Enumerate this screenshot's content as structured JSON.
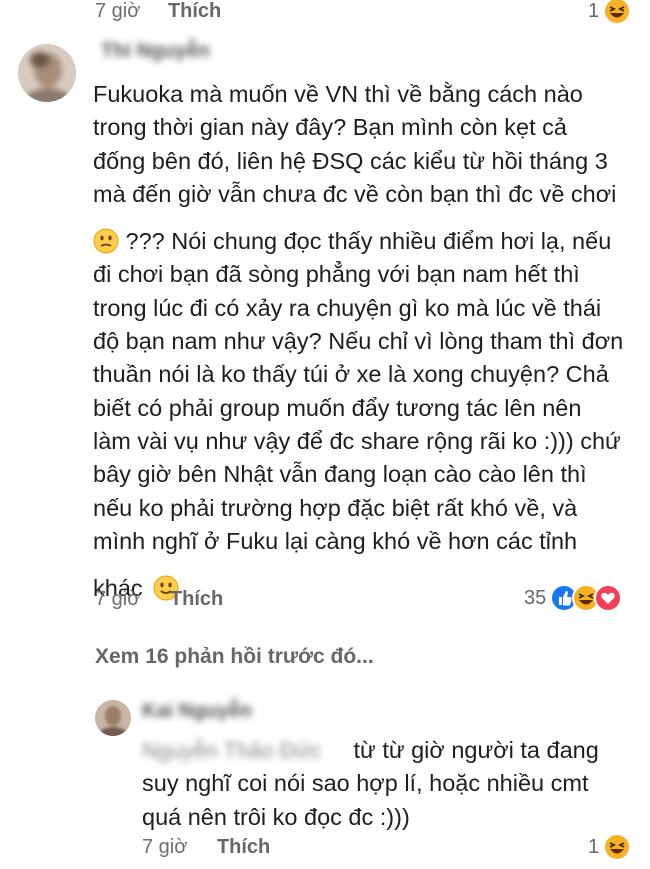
{
  "top_meta": {
    "time": "7 giờ",
    "like_action": "Thích",
    "reaction_count": "1"
  },
  "comment": {
    "author_blurred": "Thi Nguyễn",
    "paragraph1": [
      "Fukuoka mà muốn về VN thì về bằng cách nào",
      "trong thời gian này đây? Bạn mình còn kẹt cả",
      "đống bên đó, liên hệ ĐSQ các kiểu từ hồi tháng 3",
      "mà đến giờ vẫn chưa đc về còn bạn thì đc về chơi"
    ],
    "paragraph2_first_tail": "??? Nói chung đọc thấy nhiều điểm hơi lạ, nếu",
    "paragraph2": [
      "đi chơi bạn đã sòng phẳng với bạn nam hết thì",
      "trong lúc đi có xảy ra chuyện gì ko mà lúc về thái",
      "độ bạn nam như vậy? Nếu chỉ vì lòng tham thì đơn",
      "thuần nói là ko thấy túi ở xe là xong chuyện? Chả",
      "biết có phải group muốn đẩy tương tác lên nên",
      "làm vài vụ như vậy để đc share rộng rãi ko :))) chứ",
      "bây giờ bên Nhật vẫn đang loạn cào cào lên thì",
      "nếu ko phải trường hợp đặc biệt rất khó về, và",
      "mình nghĩ ở Fuku lại càng khó về hơn các tỉnh"
    ],
    "paragraph3_head": "khác",
    "time": "7 giờ",
    "like_action": "Thích",
    "reaction_count": "35"
  },
  "view_more": "Xem 16 phản hồi trước đó...",
  "reply": {
    "author_blurred": "Kai Nguyễn",
    "mention_blurred": "Nguyễn Thảo Đức",
    "first_line_tail": "từ từ giờ người ta đang",
    "lines": [
      "suy nghĩ coi nói sao hợp lí, hoặc nhiều cmt",
      "quá nên trôi ko đọc đc :)))"
    ],
    "time": "7 giờ",
    "like_action": "Thích",
    "reaction_count": "1"
  },
  "colors": {
    "text": "#1c1e21",
    "meta": "#65676b",
    "like_blue": "#1877f2",
    "love_red": "#f33e58",
    "haha_yellow": "#f7b125"
  },
  "icons": [
    "haha-reaction-icon",
    "like-reaction-icon",
    "love-reaction-icon",
    "confused-emoji-icon",
    "smile-emoji-icon"
  ]
}
